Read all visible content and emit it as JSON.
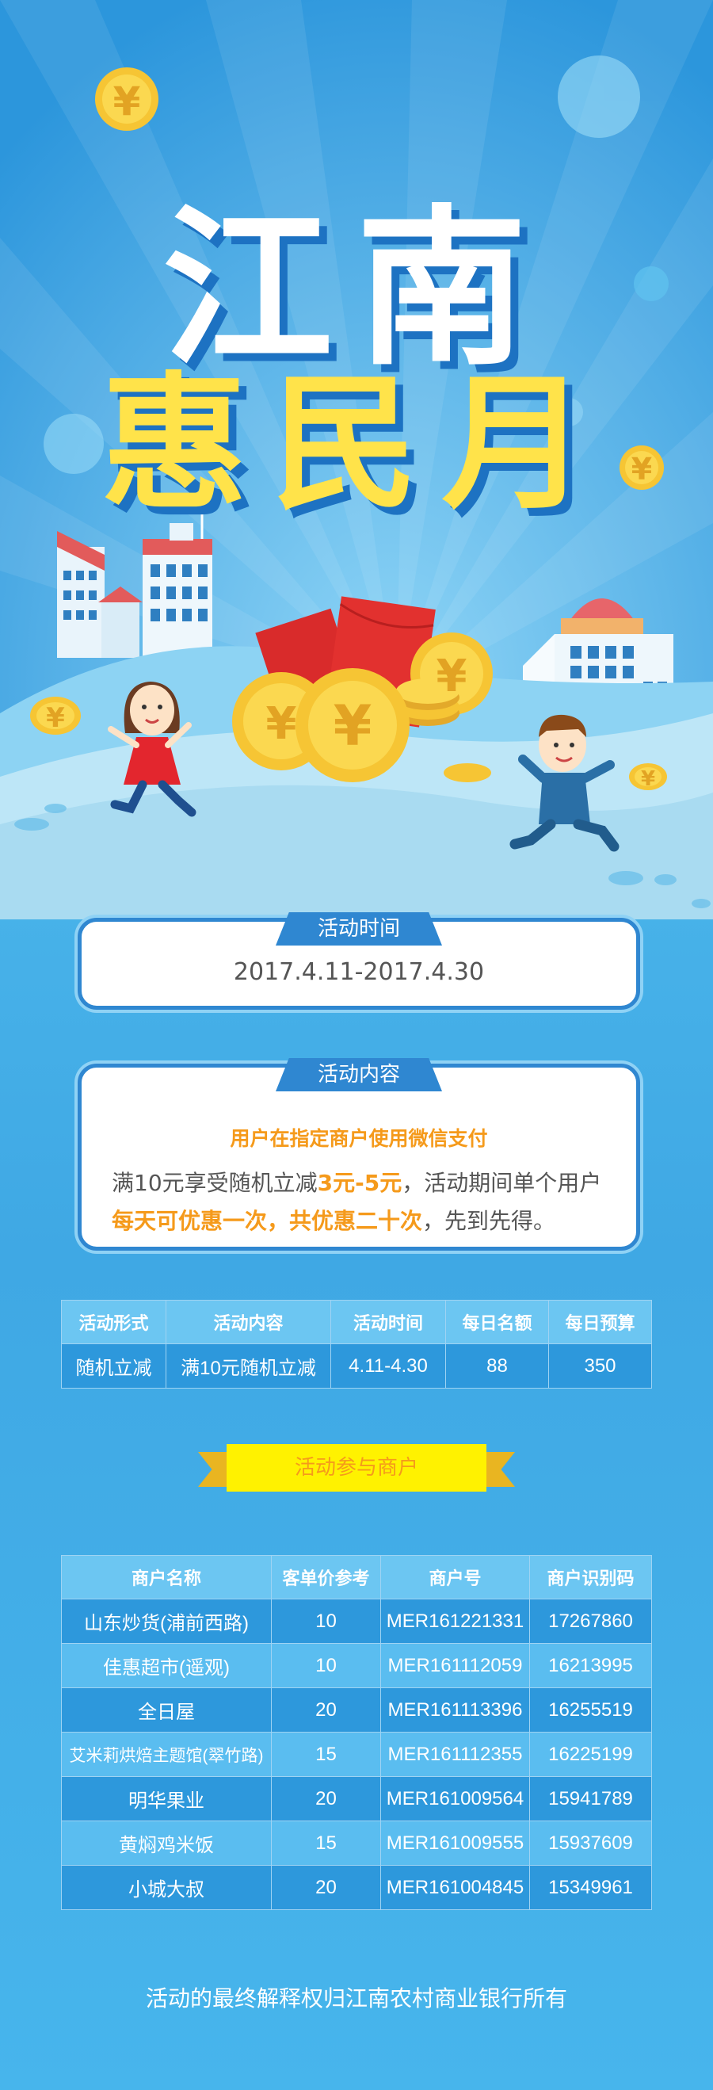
{
  "hero": {
    "title_line1": "江南",
    "title_line2": "惠民月",
    "coin_symbol": "¥"
  },
  "time_card": {
    "tab": "活动时间",
    "value": "2017.4.11-2017.4.30"
  },
  "content_card": {
    "tab": "活动内容",
    "headline": "用户在指定商户使用微信支付",
    "body_1": "满10元享受随机立减",
    "body_hl1": "3元-5元",
    "body_2": "，活动期间单个用户",
    "body_hl2": "每天可优惠一次，共优惠二十次",
    "body_3": "，先到先得。"
  },
  "summary_table": {
    "headers": [
      "活动形式",
      "活动内容",
      "活动时间",
      "每日名额",
      "每日预算"
    ],
    "row": [
      "随机立减",
      "满10元随机立减",
      "4.11-4.30",
      "88",
      "350"
    ]
  },
  "merchants_banner": "活动参与商户",
  "merchant_table": {
    "headers": [
      "商户名称",
      "客单价参考",
      "商户号",
      "商户识别码"
    ],
    "rows": [
      [
        "山东炒货(浦前西路)",
        "10",
        "MER161221331",
        "17267860"
      ],
      [
        "佳惠超市(遥观)",
        "10",
        "MER161112059",
        "16213995"
      ],
      [
        "全日屋",
        "20",
        "MER161113396",
        "16255519"
      ],
      [
        "艾米莉烘焙主题馆(翠竹路)",
        "15",
        "MER161112355",
        "16225199"
      ],
      [
        "明华果业",
        "20",
        "MER161009564",
        "15941789"
      ],
      [
        "黄焖鸡米饭",
        "15",
        "MER161009555",
        "15937609"
      ],
      [
        "小城大叔",
        "20",
        "MER161004845",
        "15349961"
      ]
    ]
  },
  "footer": "活动的最终解释权归江南农村商业银行所有",
  "colors": {
    "card_border": "#2f87d1",
    "highlight": "#f59a1b",
    "title_yellow": "#ffe34a",
    "banner_yellow": "#fff200"
  }
}
